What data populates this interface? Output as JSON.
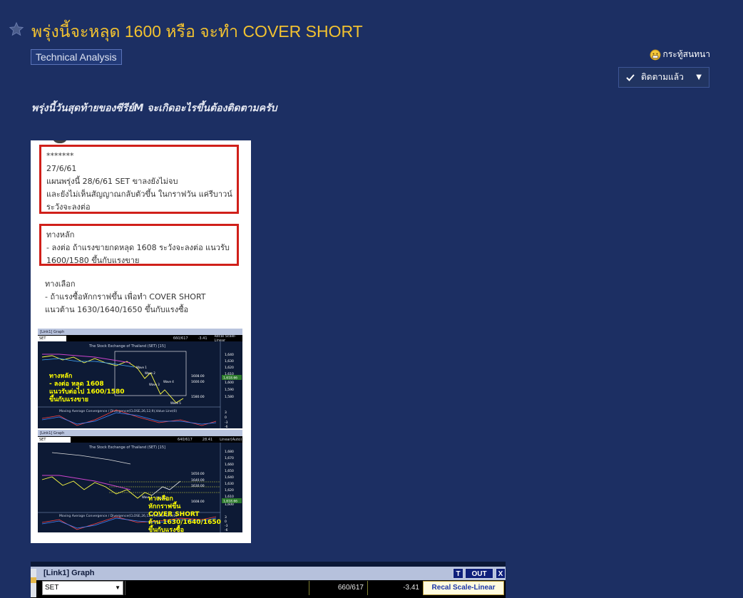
{
  "post": {
    "title": "พรุ่งนี้จะหลุด 1600 หรือ จะทำ COVER SHORT",
    "tag": "Technical Analysis",
    "kind_label": "กระทู้สนทนา",
    "follow_label": "ติดตามแล้ว",
    "lead": "พรุ่งนี้วันสุดท้ายของซีรีย์M  จะเกิดอะไรขึ้นต้องติดตามครับ",
    "title_color": "#f2c230",
    "bg_color": "#1c2f63"
  },
  "image": {
    "box1_lines": [
      "*******",
      "27/6/61",
      "แผนพรุ่งนี้ 28/6/61 SET ขาลงยังไม่จบ",
      "และยังไม่เห็นสัญญาณกลับตัวขึ้น ในกราฟวัน แค่รีบาวน์",
      "ระวังจะลงต่อ"
    ],
    "box2_lines": [
      "ทางหลัก",
      "- ลงต่อ ถ้าแรงขายกดหลุด 1608 ระวังจะลงต่อ แนวรับ",
      "1600/1580 ขึ้นกับแรงขาย"
    ],
    "plain_lines": [
      "ทางเลือก",
      "- ถ้าแรงซื้อหักกราฟขึ้น เพื่อทำ COVER SHORT",
      "แนวต้าน 1630/1640/1650 ขึ้นกับแรงซื้อ"
    ],
    "chart1": {
      "head": "[Link1] Graph",
      "symbol": "SET",
      "ratio": "660/617",
      "change": "-3.41",
      "recal": "Recal Scale-Linear",
      "subtitle": "The Stock Exchange of Thailand (SET) [15]",
      "overlay_lines": [
        "ทางหลัก",
        "- ลงต่อ หลุด 1608",
        "แนวรับต่อไป 1600/1580",
        "ขึ้นกับแรงขาย"
      ],
      "levels": [
        "1608.00",
        "1600.00",
        "1580.00"
      ],
      "waves": [
        "Wave 1",
        "Wave 2",
        "Wave 3",
        "Wave 4",
        "Wave 5"
      ],
      "price_ticks": [
        "1,640",
        "1,630",
        "1,620",
        "1,610",
        "1,600",
        "1,590",
        "1,580"
      ],
      "price_label": "1,618.66",
      "macd_label": "Moving Average Convergence / Divergence(CLOSE,26,12,9),Value Line(0)",
      "macd_ticks": [
        "3",
        "0",
        "-3",
        "-6"
      ]
    },
    "chart2": {
      "head": "[Link1] Graph",
      "symbol": "SET",
      "ratio": "640/617",
      "change": "28.41",
      "recal": "Linear(Auto)",
      "subtitle": "The Stock Exchange of Thailand (SET) [15]",
      "overlay_lines": [
        "ทางเลือก",
        "หักกราฟขึ้น",
        "COVER SHORT",
        "ต้าน 1630/1640/1650",
        "ขึ้นกับแรงซื้อ"
      ],
      "levels": [
        "1650.00",
        "1640.00",
        "1630.00",
        "1608.00"
      ],
      "waves": [
        "Wave 1",
        "Wave 2"
      ],
      "price_ticks": [
        "1,680",
        "1,670",
        "1,660",
        "1,650",
        "1,640",
        "1,630",
        "1,620",
        "1,610",
        "1,600"
      ],
      "price_label": "1,618.66",
      "macd_label": "Moving Average Convergence / Divergence(CLOSE,26,12,9),Value Line(0)",
      "macd_ticks": [
        "3",
        "0",
        "-3",
        "-6"
      ]
    }
  },
  "graphbar": {
    "title": "[Link1] Graph",
    "btn_t": "T",
    "btn_out": "OUT",
    "btn_x": "X",
    "symbol": "SET",
    "ratio": "660/617",
    "change": "-3.41",
    "recal": "Recal Scale-Linear"
  }
}
